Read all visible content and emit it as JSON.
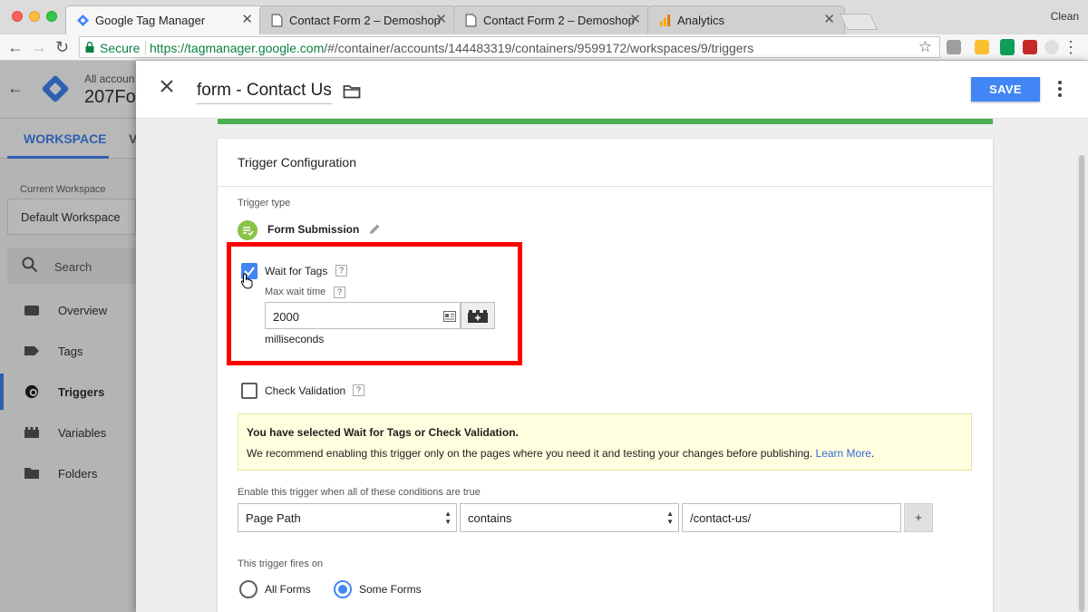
{
  "browser": {
    "tabs": [
      {
        "title": "Google Tag Manager",
        "icon": "gtm-icon",
        "active": true
      },
      {
        "title": "Contact Form 2 – Demoshop",
        "icon": "page-icon",
        "active": false
      },
      {
        "title": "Contact Form 2 – Demoshop",
        "icon": "page-icon",
        "active": false
      },
      {
        "title": "Analytics",
        "icon": "analytics-icon",
        "active": false
      }
    ],
    "user": "Clean",
    "secure_label": "Secure",
    "url_host": "https://tagmanager.google.com",
    "url_path": "/#/container/accounts/144483319/containers/9599172/workspaces/9/triggers",
    "colors": {
      "secure": "#0b8043",
      "ext_on": "#0f9d58"
    }
  },
  "gtm": {
    "account_small": "All accoun",
    "account_big": "207Fo",
    "workspace_tab": "WORKSPACE",
    "versions_tab_partial": "V",
    "current_workspace_label": "Current Workspace",
    "current_workspace": "Default Workspace",
    "search_placeholder": "Search",
    "nav": [
      {
        "label": "Overview",
        "icon": "overview-icon"
      },
      {
        "label": "Tags",
        "icon": "tag-icon"
      },
      {
        "label": "Triggers",
        "icon": "trigger-icon",
        "active": true
      },
      {
        "label": "Variables",
        "icon": "variables-icon"
      },
      {
        "label": "Folders",
        "icon": "folder-icon"
      }
    ],
    "accent": "#4285f4"
  },
  "editor": {
    "trigger_name": "form - Contact Us",
    "save_label": "SAVE",
    "card_title": "Trigger Configuration",
    "trigger_type_label": "Trigger type",
    "trigger_type": "Form Submission",
    "wait_for_tags": {
      "label": "Wait for Tags",
      "checked": true,
      "help": "?"
    },
    "max_wait_label": "Max wait time",
    "max_wait_value": "2000",
    "max_wait_unit": "milliseconds",
    "check_validation": {
      "label": "Check Validation",
      "checked": false,
      "help": "?"
    },
    "warning": {
      "title": "You have selected Wait for Tags or Check Validation.",
      "body": "We recommend enabling this trigger only on the pages where you need it and testing your changes before publishing.",
      "link": "Learn More"
    },
    "conditions_label": "Enable this trigger when all of these conditions are true",
    "condition": {
      "variable": "Page Path",
      "operator": "contains",
      "value": "/contact-us/"
    },
    "add_condition": "+",
    "fires_on_label": "This trigger fires on",
    "fires_on_options": [
      {
        "label": "All Forms",
        "selected": false
      },
      {
        "label": "Some Forms",
        "selected": true
      }
    ],
    "highlight_color": "#ff0000",
    "success_color": "#4caf50"
  }
}
